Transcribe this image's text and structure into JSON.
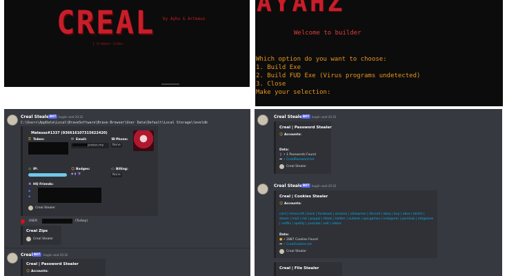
{
  "terminal_left": {
    "logo": "CREAL",
    "byline": "by Ayhu & Arteeus",
    "sub": "1 Grabber Coder"
  },
  "terminal_right": {
    "logo": "AYAHZ",
    "welcome": "Welcome to builder",
    "menu": [
      "Which option do you want to choose:",
      "1. Build Exe",
      "2. Build FUD Exe (Virus programs undetected)",
      "3. Close",
      "Make your selection:"
    ]
  },
  "discord_left": {
    "user": "Creal Stealer",
    "bot_tag": "BOT",
    "timestamp": "bugün saat 20:32",
    "path": "C:\\Users\\AppData\\Local\\BraveSoftware\\Brave-Browser\\User Data\\Default\\Local Storage\\leveldb",
    "embed": {
      "author": "Mateusz#1337 (936616107315622420)",
      "token_label": "Token:",
      "email_label": "Email:",
      "email_value": "proton.me",
      "phone_label": "Phone:",
      "phone_value": "None",
      "ip_label": "IP:",
      "badges_label": "Badges:",
      "badges_value": "◆ ▮ 🛡",
      "billing_label": "Billing:",
      "billing_value": "None",
      "friends_label": "HQ Friends:",
      "footer": "Creal Stealer"
    },
    "user_line": "USER",
    "user_country": "(Turkey)",
    "zips_title": "Creal Zips",
    "zips_footer": "Creal Stealer",
    "msg2_user": "Creal",
    "msg2_bot": "BOT",
    "msg2_ts": "bugün saat 20:32",
    "msg2_title": "Creal | Password Stealer",
    "msg2_accounts": "Accounts:"
  },
  "discord_right": {
    "msg1_user": "Creal Stealer",
    "msg1_bot": "BOT",
    "msg1_ts": "bugün saat 20:32",
    "pw_title": "Creal | Password Stealer",
    "pw_accounts": "Accounts:",
    "pw_data": "Data:",
    "pw_found": "• 1 Passwords Found",
    "pw_file": "• CrealPassword.txt",
    "pw_footer": "Creal Stealer",
    "msg2_user": "Creal Stealer",
    "msg2_bot": "BOT",
    "msg2_ts": "bugün saat 20:32",
    "ck_title": "Creal | Cookies Stealer",
    "ck_accounts": "Accounts:",
    "ck_sites": "card | minecraft | bank | facebook | amazon | aliexpress | discord | ebay | buy | xbox | twitch | steam | mail | riot | paypal | tiktok | twitter | outlook | epicgames | instagram | pornhub | riotgames | netflix | spotify | youtube | sell | roblox",
    "ck_data": "Data:",
    "ck_found": "• 2887 Cookies Found",
    "ck_file": "• CrealCookies.txt",
    "ck_footer": "Creal Stealer",
    "fs_title": "Creal | File Stealer"
  }
}
